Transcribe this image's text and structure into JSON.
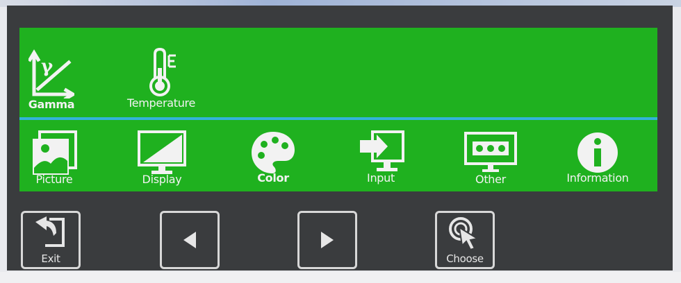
{
  "osd": {
    "submenu": [
      {
        "label": "Gamma",
        "icon": "gamma-icon",
        "selected": true
      },
      {
        "label": "Temperature",
        "icon": "thermometer-icon",
        "selected": false
      }
    ],
    "menu": [
      {
        "label": "Picture",
        "icon": "picture-icon"
      },
      {
        "label": "Display",
        "icon": "display-icon"
      },
      {
        "label": "Color",
        "icon": "palette-icon",
        "selected": true
      },
      {
        "label": "Input",
        "icon": "input-icon"
      },
      {
        "label": "Other",
        "icon": "other-icon"
      },
      {
        "label": "Information",
        "icon": "information-icon"
      }
    ]
  },
  "buttons": {
    "exit": {
      "label": "Exit",
      "icon": "exit-icon"
    },
    "left": {
      "icon": "left-arrow-icon"
    },
    "right": {
      "icon": "right-arrow-icon"
    },
    "choose": {
      "label": "Choose",
      "icon": "choose-icon"
    }
  },
  "colors": {
    "osd_background": "#1fb11f",
    "divider": "#33b3d8",
    "bezel": "#3a3c3e",
    "foreground": "#f2f2f2"
  }
}
